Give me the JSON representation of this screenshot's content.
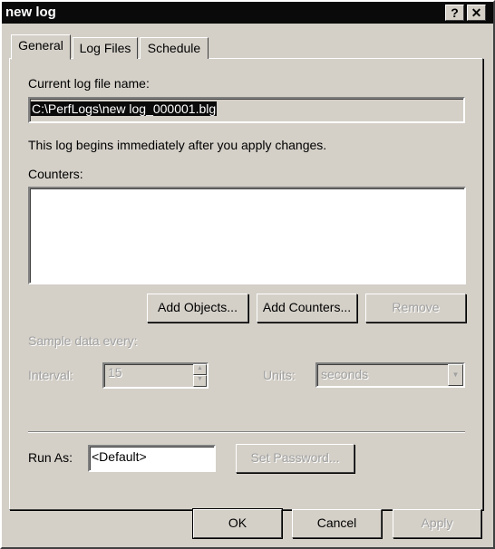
{
  "window": {
    "title": "new log",
    "help_label": "?",
    "close_label": "✕"
  },
  "tabs": [
    {
      "label": "General",
      "active": true
    },
    {
      "label": "Log Files"
    },
    {
      "label": "Schedule"
    }
  ],
  "general": {
    "current_file_label": "Current log file name:",
    "current_file_value": "C:\\PerfLogs\\new log_000001.blg",
    "info_text": "This log begins immediately after you apply changes.",
    "counters_label": "Counters:",
    "counters": [],
    "add_objects": "Add Objects...",
    "add_counters": "Add Counters...",
    "remove": "Remove",
    "sample_label": "Sample data every:",
    "interval_label": "Interval:",
    "interval_value": "15",
    "units_label": "Units:",
    "units_value": "seconds",
    "run_as_label": "Run As:",
    "run_as_value": "<Default>",
    "set_password": "Set Password..."
  },
  "footer": {
    "ok": "OK",
    "cancel": "Cancel",
    "apply": "Apply"
  }
}
